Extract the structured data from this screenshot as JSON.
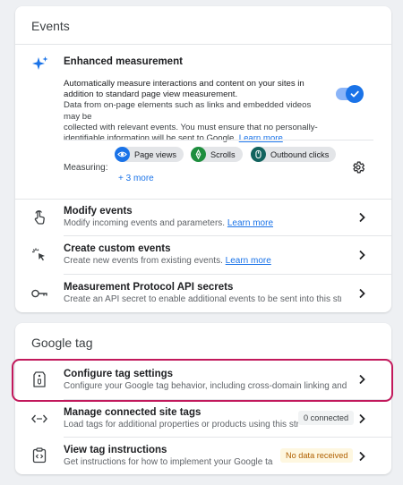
{
  "events": {
    "title": "Events",
    "enhanced": {
      "title": "Enhanced measurement",
      "desc_line1": "Automatically measure interactions and content on your sites in",
      "desc_line2": "addition to standard page view measurement.",
      "desc_line3": "Data from on-page elements such as links and embedded videos may be",
      "desc_line4": "collected with relevant events. You must ensure that no personally-",
      "desc_line5": "identifiable information will be sent to Google.",
      "learn_more": "Learn more",
      "toggle_on": true,
      "measuring_label": "Measuring:",
      "chips": [
        {
          "label": "Page views",
          "icon": "eye-icon",
          "color": "#1a73e8",
          "bg": "#d2e3fc"
        },
        {
          "label": "Scrolls",
          "icon": "crosshair-icon",
          "color": "#1e8e3e",
          "bg": "#1e8e3e"
        },
        {
          "label": "Outbound clicks",
          "icon": "mouse-icon",
          "color": "#137333",
          "bg": "#0f5f5c"
        }
      ],
      "more": "+ 3 more"
    },
    "rows": [
      {
        "title": "Modify events",
        "desc": "Modify incoming events and parameters.",
        "link": "Learn more",
        "icon": "touch-icon"
      },
      {
        "title": "Create custom events",
        "desc": "Create new events from existing events.",
        "link": "Learn more",
        "icon": "sparkle-click-icon"
      },
      {
        "title": "Measurement Protocol API secrets",
        "desc": "Create an API secret to enable additional events to be sent into this strea...",
        "link": "",
        "icon": "key-icon"
      }
    ]
  },
  "gtag": {
    "title": "Google tag",
    "rows": [
      {
        "title": "Configure tag settings",
        "desc": "Configure your Google tag behavior, including cross-domain linking and in...",
        "status": "",
        "icon": "tag-icon"
      },
      {
        "title": "Manage connected site tags",
        "desc": "Load tags for additional properties or products using this str...",
        "status": "0 connected",
        "icon": "code-arrows-icon"
      },
      {
        "title": "View tag instructions",
        "desc": "Get instructions for how to implement your Google tag f...",
        "status": "No data received",
        "icon": "clipboard-code-icon"
      }
    ]
  },
  "colors": {
    "accent": "#1a73e8",
    "highlight": "#c2185b",
    "warning_bg": "#fef7e0",
    "warning_text": "#b06000"
  }
}
